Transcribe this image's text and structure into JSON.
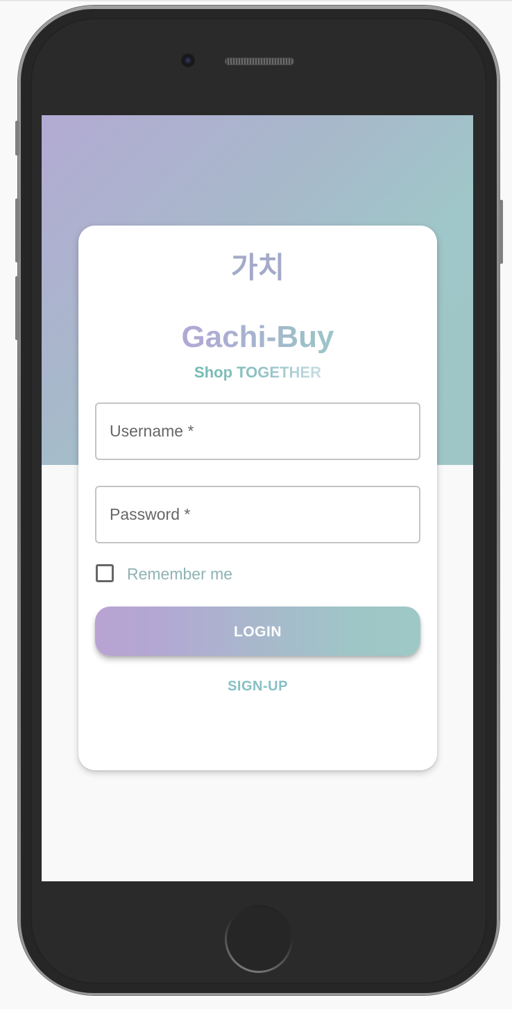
{
  "app": {
    "korean_logo": "가치",
    "title": "Gachi-Buy",
    "tagline_part1": "Shop ",
    "tagline_part2": "TOGETHER"
  },
  "form": {
    "username": {
      "label": "Username",
      "required_mark": " *",
      "value": ""
    },
    "password": {
      "label": "Password",
      "required_mark": " *",
      "value": ""
    },
    "remember": {
      "label": "Remember me",
      "checked": false
    },
    "login_label": "LOGIN",
    "signup_label": "SIGN-UP"
  },
  "colors": {
    "gradient_start": "#b3aad3",
    "gradient_end": "#9ec6c6",
    "page_background": "#f9f9f9",
    "card_background": "#ffffff",
    "label_gray": "#666666",
    "remember_text": "#8fb3b3",
    "signup_text": "#86c0c4"
  },
  "icons": {
    "device_camera": "camera-icon",
    "home_button": "home-button-icon",
    "checkbox": "checkbox-unchecked-icon"
  }
}
